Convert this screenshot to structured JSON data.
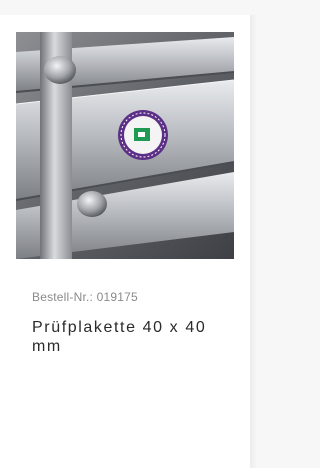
{
  "product": {
    "image_icon": "product-photo",
    "order_number": "Bestell-Nr.: 019175",
    "title": "Prüfplakette 40 x 40 mm"
  },
  "colors": {
    "background": "#f7f7f7",
    "card": "#ffffff",
    "order_text": "#8a8a8a",
    "title_text": "#2b2b2b",
    "badge_purple": "#5b2f86",
    "badge_green": "#1e9a52"
  }
}
